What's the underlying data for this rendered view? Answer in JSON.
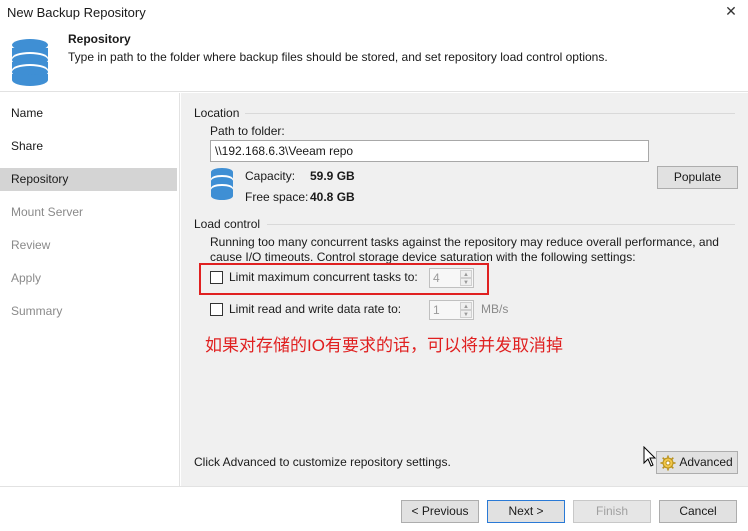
{
  "window": {
    "title": "New Backup Repository",
    "close_glyph": "✕"
  },
  "header": {
    "title": "Repository",
    "description": "Type in path to the folder where backup files should be stored, and set repository load control options.",
    "icon": "database-icon"
  },
  "sidebar": {
    "items": [
      {
        "label": "Name",
        "state": "normal"
      },
      {
        "label": "Share",
        "state": "normal"
      },
      {
        "label": "Repository",
        "state": "active"
      },
      {
        "label": "Mount Server",
        "state": "dim"
      },
      {
        "label": "Review",
        "state": "dim"
      },
      {
        "label": "Apply",
        "state": "dim"
      },
      {
        "label": "Summary",
        "state": "dim"
      }
    ]
  },
  "location": {
    "group_label": "Location",
    "path_label": "Path to folder:",
    "path_value": "\\\\192.168.6.3\\Veeam repo",
    "populate_label": "Populate",
    "capacity_label": "Capacity:",
    "capacity_value": "59.9 GB",
    "free_label": "Free space:",
    "free_value": "40.8 GB"
  },
  "load_control": {
    "group_label": "Load control",
    "description": "Running too many concurrent tasks against the repository may reduce overall performance, and cause I/O timeouts. Control storage device saturation with the following settings:",
    "limit_tasks_label": "Limit maximum concurrent tasks to:",
    "limit_tasks_checked": false,
    "limit_tasks_value": "4",
    "limit_rate_label": "Limit read and write data rate to:",
    "limit_rate_checked": false,
    "limit_rate_value": "1",
    "limit_rate_unit": "MB/s"
  },
  "annotation": {
    "text": "如果对存储的IO有要求的话，可以将并发取消掉",
    "color": "#e02020"
  },
  "advanced": {
    "hint": "Click Advanced to customize repository settings.",
    "button_label": "Advanced"
  },
  "nav_buttons": {
    "previous": "< Previous",
    "next": "Next >",
    "finish": "Finish",
    "cancel": "Cancel"
  },
  "colors": {
    "accent": "#2a7ad6",
    "db_icon": "#3f8fd4",
    "highlight": "#e02020"
  }
}
